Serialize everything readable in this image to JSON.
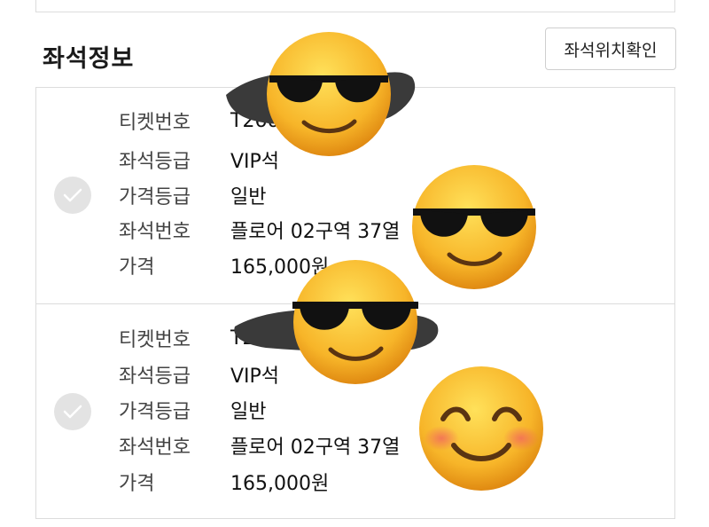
{
  "section": {
    "title": "좌석정보",
    "seat_map_button": "좌석위치확인"
  },
  "tickets": [
    {
      "rows": [
        {
          "label": "티켓번호",
          "value": "T260"
        },
        {
          "label": "좌석등급",
          "value": "VIP석"
        },
        {
          "label": "가격등급",
          "value": "일반"
        },
        {
          "label": "좌석번호",
          "value": "플로어 02구역 37열"
        },
        {
          "label": "가격",
          "value": "165,000원"
        }
      ],
      "checked": false
    },
    {
      "rows": [
        {
          "label": "티켓번호",
          "value": "T260"
        },
        {
          "label": "좌석등급",
          "value": "VIP석"
        },
        {
          "label": "가격등급",
          "value": "일반"
        },
        {
          "label": "좌석번호",
          "value": "플로어 02구역 37열"
        },
        {
          "label": "가격",
          "value": "165,000원"
        }
      ],
      "checked": false
    }
  ],
  "icons": {
    "check": "check-circle-icon",
    "cover": "sunglasses-emoji-icon",
    "smile": "smiling-emoji-icon"
  },
  "colors": {
    "border": "#dcdcdc",
    "check_bg": "#e3e3e3",
    "emoji_yellow": "#f7b529",
    "scribble": "#3a3a3a"
  }
}
